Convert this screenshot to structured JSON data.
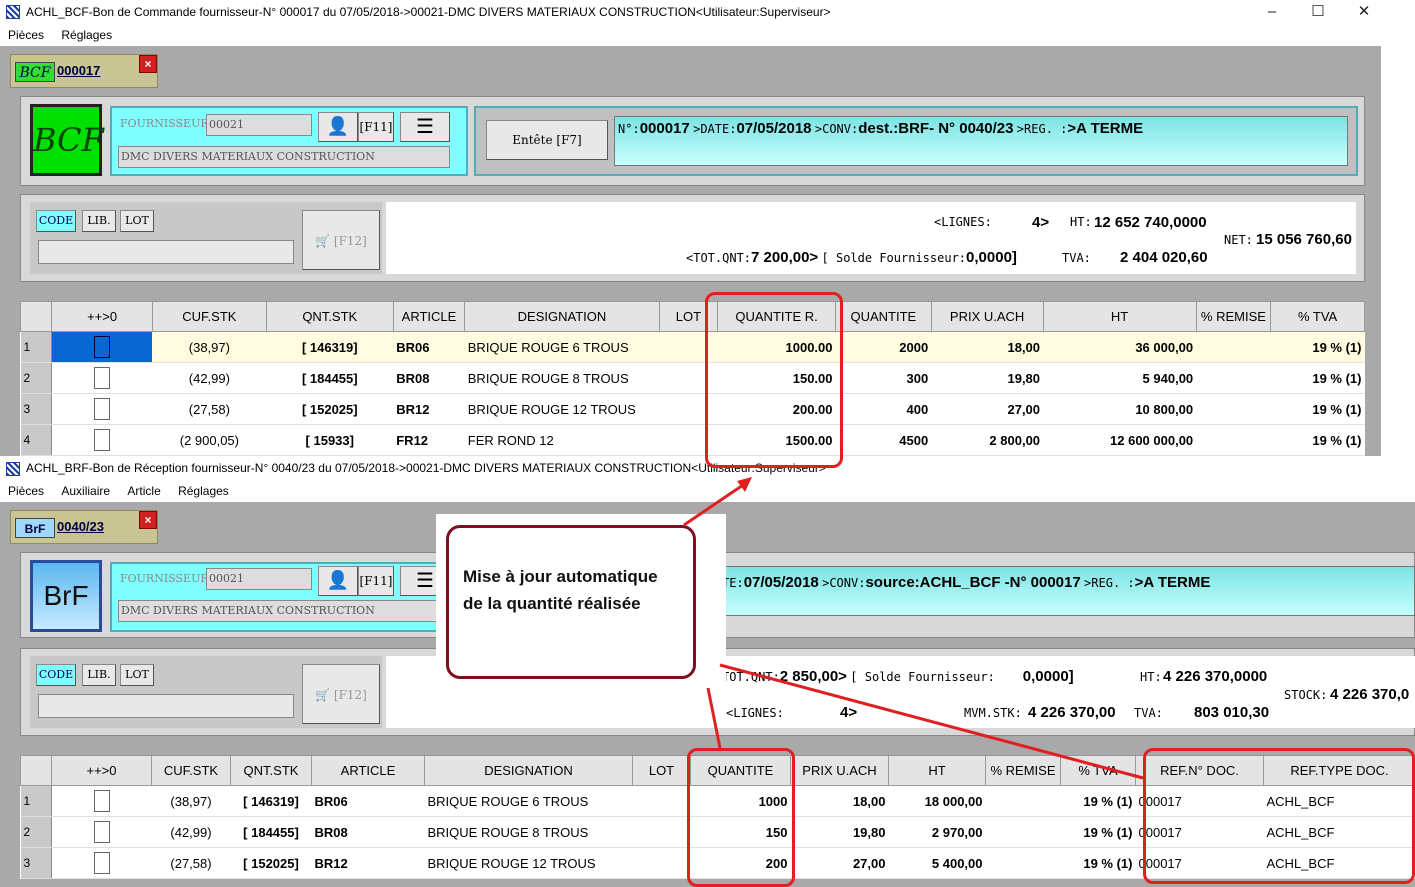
{
  "win1": {
    "title": "ACHL_BCF-Bon de Commande fournisseur-N° 000017 du 07/05/2018->00021-DMC DIVERS MATERIAUX CONSTRUCTION<Utilisateur:Superviseur>",
    "menu": [
      "Pièces",
      "Réglages"
    ],
    "tab_icon": "BCF",
    "tab_label": "000017",
    "logo": "BCF",
    "fourn_label": "FOURNISSEUR:",
    "fourn_code": "00021",
    "fourn_name": "DMC DIVERS MATERIAUX CONSTRUCTION",
    "f11": "[F11]",
    "entete_btn": "Entête [F7]",
    "info": {
      "n_lbl": "N°:",
      "n_val": "000017",
      "date_lbl": ">DATE:",
      "date_val": "07/05/2018",
      "conv_lbl": ">CONV:",
      "conv_val": "dest.:BRF- N° 0040/23",
      "reg_lbl": ">REG.  :",
      "reg_val": ">A TERME"
    },
    "tabs": [
      "CODE",
      "LIB.",
      "LOT"
    ],
    "f12": "[F12]",
    "lignes_lbl": "<LIGNES:",
    "lignes_val": "4>",
    "ht_lbl": "HT:",
    "ht_val": "12 652 740,0000",
    "net_lbl": "NET:",
    "net_val": "15 056 760,60",
    "totqnt_lbl": "<TOT.QNT:",
    "totqnt_val": "7 200,00>",
    "solde_lbl": "[ Solde Fournisseur:",
    "solde_val": "0,0000]",
    "tva_lbl": "TVA:",
    "tva_val": "2 404 020,60",
    "columns": [
      "",
      "++>0",
      "CUF.STK",
      "QNT.STK",
      "ARTICLE",
      "DESIGNATION",
      "LOT",
      "QUANTITE R.",
      "QUANTITE",
      "PRIX U.ACH",
      "HT",
      "% REMISE",
      "% TVA"
    ],
    "rows": [
      [
        "1",
        "",
        "(38,97)",
        "[ 146319]",
        "BR06",
        "BRIQUE ROUGE 6 TROUS",
        "",
        "1000.00",
        "2000",
        "18,00",
        "36 000,00",
        "",
        "19 % (1)"
      ],
      [
        "2",
        "",
        "(42,99)",
        "[ 184455]",
        "BR08",
        "BRIQUE ROUGE 8 TROUS",
        "",
        "150.00",
        "300",
        "19,80",
        "5 940,00",
        "",
        "19 % (1)"
      ],
      [
        "3",
        "",
        "(27,58)",
        "[ 152025]",
        "BR12",
        "BRIQUE ROUGE 12 TROUS",
        "",
        "200.00",
        "400",
        "27,00",
        "10 800,00",
        "",
        "19 % (1)"
      ],
      [
        "4",
        "",
        "(2 900,05)",
        "[ 15933]",
        "FR12",
        "FER ROND 12",
        "",
        "1500.00",
        "4500",
        "2 800,00",
        "12 600 000,00",
        "",
        "19 % (1)"
      ]
    ]
  },
  "win2": {
    "title": "ACHL_BRF-Bon de Réception fournisseur-N° 0040/23 du 07/05/2018->00021-DMC DIVERS MATERIAUX CONSTRUCTION<Utilisateur:Superviseur>",
    "menu": [
      "Pièces",
      "Auxiliaire",
      "Article",
      "Réglages"
    ],
    "tab_icon": "BrF",
    "tab_label": "0040/23",
    "logo": "BrF",
    "fourn_label": "FOURNISSEUR:",
    "fourn_code": "00021",
    "fourn_name": "DMC DIVERS MATERIAUX CONSTRUCTION",
    "f11": "[F11]",
    "info": {
      "date_lbl": "TE:",
      "date_val": "07/05/2018",
      "conv_lbl": ">CONV:",
      "conv_val": "source:ACHL_BCF -N° 000017",
      "reg_lbl": ">REG.  :",
      "reg_val": ">A TERME"
    },
    "tabs": [
      "CODE",
      "LIB.",
      "LOT"
    ],
    "f12": "[F12]",
    "totqnt_lbl": "TOT.QNT:",
    "totqnt_val": "2 850,00>",
    "solde_lbl": "[ Solde Fournisseur:",
    "solde_val": "0,0000]",
    "ht_lbl": "HT:",
    "ht_val": "4 226 370,0000",
    "stock_lbl": "STOCK:",
    "stock_val": "4 226 370,0",
    "lignes_lbl": "<LIGNES:",
    "lignes_val": "4>",
    "mvm_lbl": "MVM.STK:",
    "mvm_val": "4 226 370,00",
    "tva_lbl": "TVA:",
    "tva_val": "803 010,30",
    "columns": [
      "",
      "++>0",
      "CUF.STK",
      "QNT.STK",
      "ARTICLE",
      "DESIGNATION",
      "LOT",
      "QUANTITE",
      "PRIX U.ACH",
      "HT",
      "% REMISE",
      "% TVA",
      "REF.N° DOC.",
      "REF.TYPE DOC."
    ],
    "rows": [
      [
        "1",
        "",
        "(38,97)",
        "[ 146319]",
        "BR06",
        "BRIQUE ROUGE 6 TROUS",
        "",
        "1000",
        "18,00",
        "18 000,00",
        "",
        "19 % (1)",
        "000017",
        "ACHL_BCF"
      ],
      [
        "2",
        "",
        "(42,99)",
        "[ 184455]",
        "BR08",
        "BRIQUE ROUGE 8 TROUS",
        "",
        "150",
        "19,80",
        "2 970,00",
        "",
        "19 % (1)",
        "000017",
        "ACHL_BCF"
      ],
      [
        "3",
        "",
        "(27,58)",
        "[ 152025]",
        "BR12",
        "BRIQUE ROUGE 12 TROUS",
        "",
        "200",
        "27,00",
        "5 400,00",
        "",
        "19 % (1)",
        "000017",
        "ACHL_BCF"
      ]
    ]
  },
  "callout": {
    "line1": "Mise à jour automatique",
    "line2": "de la quantité réalisée"
  },
  "colors": {
    "cyan": "#80ffff",
    "logo_green": "#00e000",
    "tab_bg": "#c9c493",
    "highlight": "#e02020"
  }
}
